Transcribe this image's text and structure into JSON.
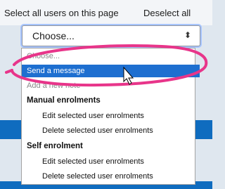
{
  "bulk_actions": {
    "select_all_label": "Select all users on this page",
    "deselect_all_label": "Deselect all"
  },
  "action_select": {
    "current_value": "Choose...",
    "options": [
      {
        "label": "Choose..."
      },
      {
        "label": "Send a message",
        "selected": true
      },
      {
        "label": "Add a new note"
      }
    ],
    "groups": [
      {
        "label": "Manual enrolments",
        "options": [
          {
            "label": "Edit selected user enrolments"
          },
          {
            "label": "Delete selected user enrolments"
          }
        ]
      },
      {
        "label": "Self enrolment",
        "options": [
          {
            "label": "Edit selected user enrolments"
          },
          {
            "label": "Delete selected user enrolments"
          }
        ]
      }
    ]
  },
  "colors": {
    "accent": "#0f6cbf",
    "highlight": "#1e6fd0",
    "annotation": "#e8358a"
  },
  "annotation": {
    "shape": "ellipse-outline",
    "pointer": "mouse-cursor-icon"
  }
}
